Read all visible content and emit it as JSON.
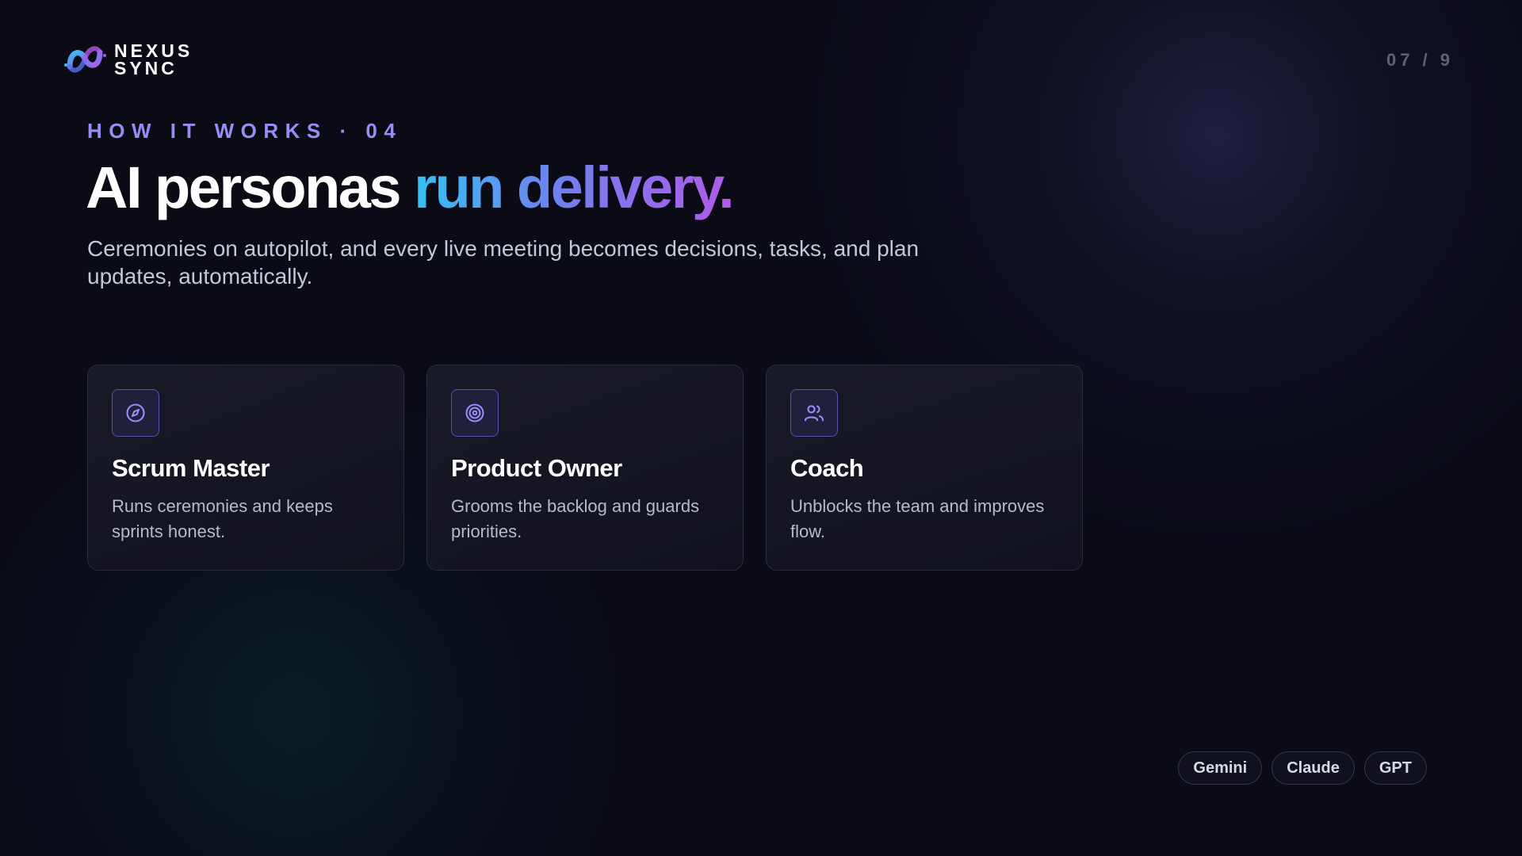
{
  "brand": {
    "line1": "NEXUS",
    "line2": "SYNC",
    "logo_icon": "infinity-s-logo-icon"
  },
  "pagination": {
    "label": "07 / 9"
  },
  "header": {
    "eyebrow": "HOW IT WORKS · 04",
    "title_plain": "AI personas ",
    "title_accent": "run delivery.",
    "subtitle": "Ceremonies on autopilot, and every live meeting becomes decisions, tasks, and plan updates, automatically."
  },
  "personas": [
    {
      "icon": "compass-icon",
      "title": "Scrum Master",
      "description": "Runs ceremonies and keeps sprints honest."
    },
    {
      "icon": "target-icon",
      "title": "Product Owner",
      "description": "Grooms the backlog and guards priorities."
    },
    {
      "icon": "users-icon",
      "title": "Coach",
      "description": "Unblocks the team and improves flow."
    }
  ],
  "models": [
    "Gemini",
    "Claude",
    "GPT"
  ],
  "colors": {
    "background": "#0a0b15",
    "eyebrow": "#9a8cf6",
    "accent_start": "#35c1f1",
    "accent_mid": "#6f80f0",
    "accent_end": "#b15ae8",
    "icon_stroke": "#9a8cf6"
  }
}
